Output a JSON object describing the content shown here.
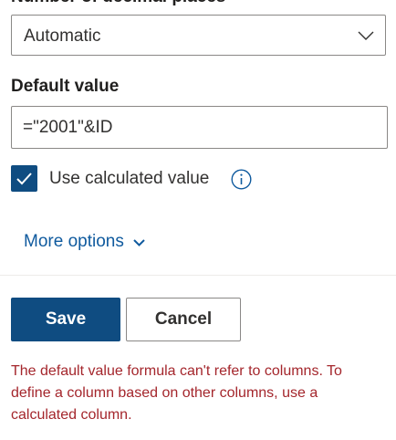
{
  "decimal_places": {
    "label": "Number of decimal places",
    "selected_value": "Automatic",
    "chevron_icon": "chevron-down-icon"
  },
  "default_value": {
    "label": "Default value",
    "input_value": "=\"2001\"&ID"
  },
  "use_calculated": {
    "checked": true,
    "label": "Use calculated value",
    "info_icon": "info-icon"
  },
  "more_options": {
    "label": "More options",
    "icon": "chevron-down-icon"
  },
  "actions": {
    "save_label": "Save",
    "cancel_label": "Cancel"
  },
  "error": {
    "message": "The default value formula can't refer to columns. To\ndefine a column based on other columns, use a\ncalculated column."
  },
  "colors": {
    "primary": "#0f4c81",
    "link": "#0f5a9e",
    "error": "#a4262c",
    "border": "#8a8886"
  }
}
